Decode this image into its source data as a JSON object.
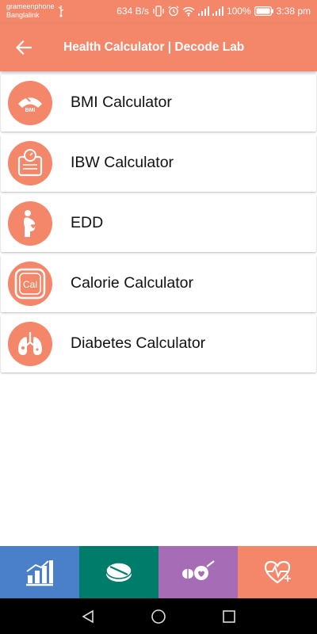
{
  "status_bar": {
    "carrier_1": "grameenphone",
    "carrier_2": "Banglalink",
    "network_speed": "634 B/s",
    "battery": "100%",
    "time": "3:38 pm"
  },
  "app_bar": {
    "title": "Health Calculator | Decode Lab"
  },
  "list": {
    "items": [
      {
        "label": "BMI Calculator",
        "icon": "bmi-scale-icon",
        "icon_text": "BMI"
      },
      {
        "label": "IBW Calculator",
        "icon": "weight-scale-icon"
      },
      {
        "label": "EDD",
        "icon": "pregnant-woman-icon"
      },
      {
        "label": "Calorie Calculator",
        "icon": "calorie-icon",
        "icon_text": "Cal"
      },
      {
        "label": "Diabetes Calculator",
        "icon": "lungs-icon"
      }
    ]
  },
  "bottom_nav": {
    "tabs": [
      {
        "icon": "bar-chart-icon",
        "color": "#4a7fc9"
      },
      {
        "icon": "pill-icon",
        "color": "#007c6b"
      },
      {
        "icon": "pills-heart-icon",
        "color": "#a66cb5"
      },
      {
        "icon": "heart-rate-icon",
        "color": "#f4876a"
      }
    ]
  },
  "colors": {
    "primary": "#f4876a",
    "text": "#111111",
    "system_nav": "#000000"
  }
}
